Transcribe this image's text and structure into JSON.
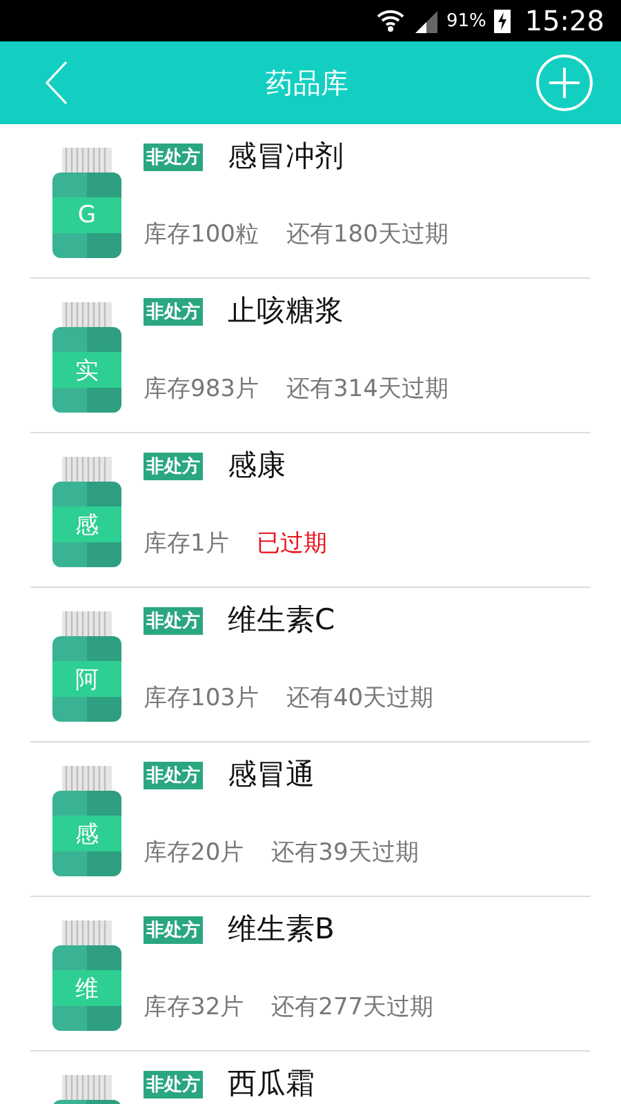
{
  "status_bar": {
    "battery": "91%",
    "time": "15:28"
  },
  "header": {
    "title": "药品库"
  },
  "medicines": [
    {
      "letter": "G",
      "label": "非处方",
      "name": "感冒冲剂",
      "stock": "库存100粒",
      "expiry": "还有180天过期",
      "expired": false
    },
    {
      "letter": "实",
      "label": "非处方",
      "name": "止咳糖浆",
      "stock": "库存983片",
      "expiry": "还有314天过期",
      "expired": false
    },
    {
      "letter": "感",
      "label": "非处方",
      "name": "感康",
      "stock": "库存1片",
      "expiry": "已过期",
      "expired": true
    },
    {
      "letter": "阿",
      "label": "非处方",
      "name": "维生素C",
      "stock": "库存103片",
      "expiry": "还有40天过期",
      "expired": false
    },
    {
      "letter": "感",
      "label": "非处方",
      "name": "感冒通",
      "stock": "库存20片",
      "expiry": "还有39天过期",
      "expired": false
    },
    {
      "letter": "维",
      "label": "非处方",
      "name": "维生素B",
      "stock": "库存32片",
      "expiry": "还有277天过期",
      "expired": false
    },
    {
      "label": "非处方",
      "name": "西瓜霜"
    }
  ]
}
